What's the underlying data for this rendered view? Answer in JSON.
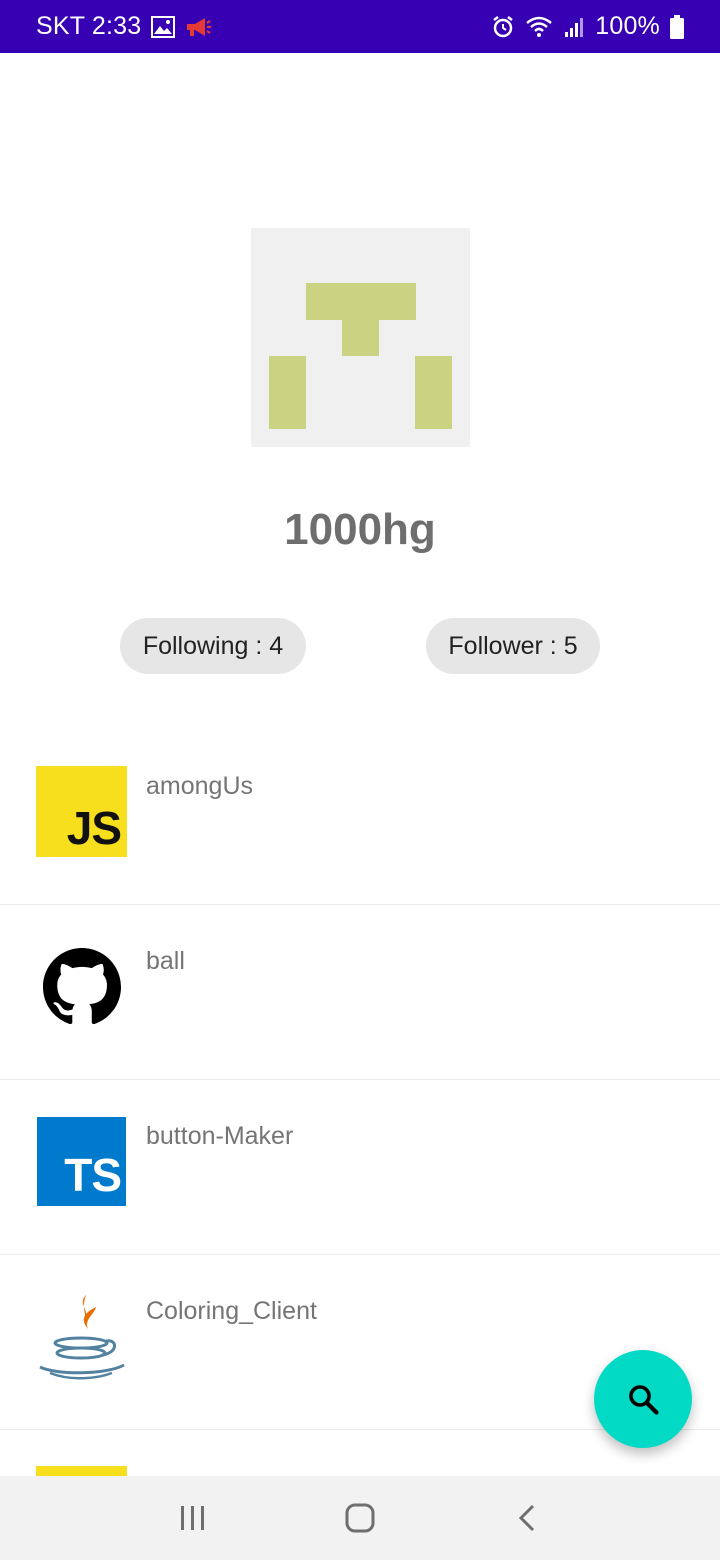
{
  "status_bar": {
    "carrier_time": "SKT 2:33",
    "battery": "100%",
    "background": "#3700B3",
    "icons": [
      "gallery-icon",
      "megaphone-icon",
      "alarm-icon",
      "wifi-icon",
      "signal-icon",
      "battery-icon"
    ]
  },
  "profile": {
    "username": "1000hg",
    "avatar_icon": "identicon-avatar",
    "avatar_color": "#CBD281",
    "following_label": "Following : 4",
    "follower_label": "Follower : 5"
  },
  "repos": [
    {
      "name": "amongUs",
      "icon": "javascript-icon",
      "icon_text": "JS"
    },
    {
      "name": "ball",
      "icon": "github-icon"
    },
    {
      "name": "button-Maker",
      "icon": "typescript-icon",
      "icon_text": "TS"
    },
    {
      "name": "Coloring_Client",
      "icon": "java-icon"
    }
  ],
  "fab": {
    "icon": "search-icon",
    "color": "#03DAC5"
  },
  "nav_bar": {
    "icons": [
      "recent-apps-icon",
      "home-icon",
      "back-icon"
    ]
  }
}
